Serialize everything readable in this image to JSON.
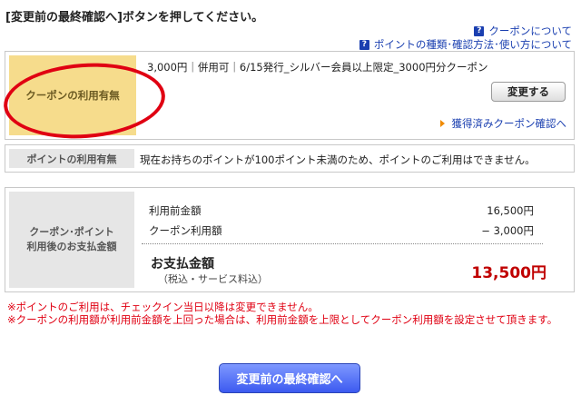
{
  "instruction": "[変更前の最終確認へ]ボタンを押してください。",
  "help_links": {
    "coupon_about": "クーポンについて",
    "points_about": "ポイントの種類･確認方法･使い方について",
    "icon_glyph": "?"
  },
  "coupon": {
    "label": "クーポンの利用有無",
    "description": "3,000円｜併用可｜6/15発行_シルバー会員以上限定_3000円分クーポン",
    "change_button": "変更する",
    "acquired_link": "獲得済みクーポン確認へ"
  },
  "points": {
    "label": "ポイントの利用有無",
    "message": "現在お持ちのポイントが100ポイント未満のため、ポイントのご利用はできません。"
  },
  "payment": {
    "label_line1": "クーポン･ポイント",
    "label_line2": "利用後のお支払金額",
    "rows": [
      {
        "label": "利用前金額",
        "value": "16,500円"
      },
      {
        "label": "クーポン利用額",
        "value": "− 3,000円"
      }
    ],
    "total_label": "お支払金額",
    "total_sub": "（税込・サービス料込）",
    "total_amount": "13,500円"
  },
  "notes": [
    "※ポイントのご利用は、チェックイン当日以降は変更できません。",
    "※クーポンの利用額が利用前金額を上回った場合は、利用前金額を上限としてクーポン利用額を設定させて頂きます。"
  ],
  "confirm_button": "変更前の最終確認へ",
  "colors": {
    "accent_blue": "#1a3fb0",
    "alert_red": "#e00012",
    "coupon_label_bg": "#f6dc8c",
    "total_red": "#c00000"
  }
}
